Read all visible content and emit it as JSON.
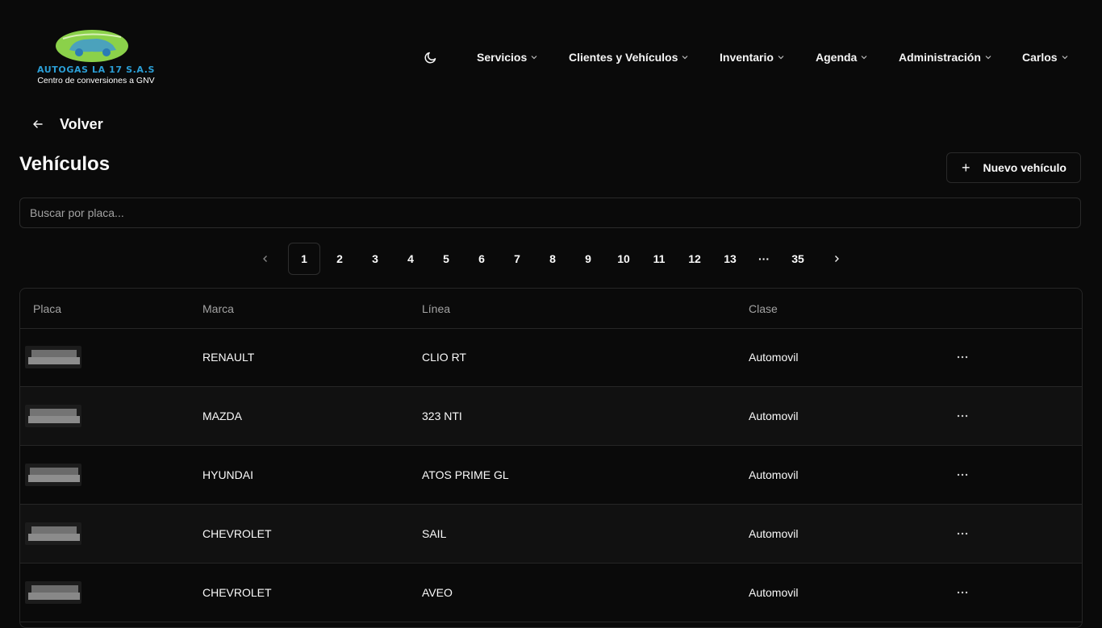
{
  "brand": {
    "name": "AUTOGAS LA 17 S.A.S",
    "tagline": "Centro de conversiones a GNV",
    "colors": {
      "blue": "#2b9fd6",
      "green": "#8bd14a"
    }
  },
  "header": {
    "theme_icon": "moon-icon",
    "nav": [
      {
        "label": "Servicios"
      },
      {
        "label": "Clientes y Vehículos"
      },
      {
        "label": "Inventario"
      },
      {
        "label": "Agenda"
      },
      {
        "label": "Administración"
      },
      {
        "label": "Carlos"
      }
    ]
  },
  "back": {
    "label": "Volver",
    "icon": "arrow-left-icon"
  },
  "page": {
    "title": "Vehículos",
    "new_button": "Nuevo vehículo",
    "new_icon": "plus-icon"
  },
  "search": {
    "placeholder": "Buscar por placa...",
    "value": ""
  },
  "pagination": {
    "current": 1,
    "pages": [
      "1",
      "2",
      "3",
      "4",
      "5",
      "6",
      "7",
      "8",
      "9",
      "10",
      "11",
      "12",
      "13",
      "35"
    ],
    "ellipsis": "···",
    "prev_icon": "chevron-left-icon",
    "next_icon": "chevron-right-icon"
  },
  "table": {
    "columns": [
      "Placa",
      "Marca",
      "Línea",
      "Clase"
    ],
    "rows": [
      {
        "placa": "",
        "marca": "RENAULT",
        "linea": "CLIO RT",
        "clase": "Automovil"
      },
      {
        "placa": "",
        "marca": "MAZDA",
        "linea": "323 NTI",
        "clase": "Automovil"
      },
      {
        "placa": "",
        "marca": "HYUNDAI",
        "linea": "ATOS PRIME GL",
        "clase": "Automovil"
      },
      {
        "placa": "",
        "marca": "CHEVROLET",
        "linea": "SAIL",
        "clase": "Automovil"
      },
      {
        "placa": "",
        "marca": "CHEVROLET",
        "linea": "AVEO",
        "clase": "Automovil"
      }
    ],
    "row_action_icon": "more-horizontal-icon"
  }
}
